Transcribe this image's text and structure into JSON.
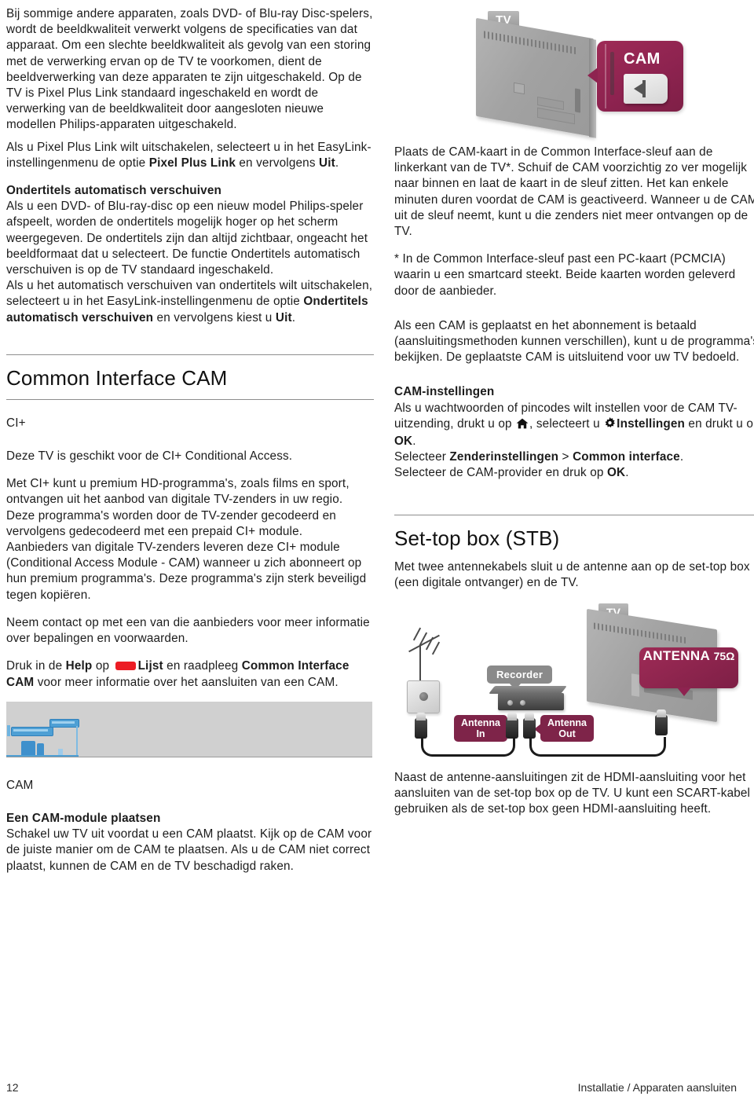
{
  "page": {
    "number": "12",
    "footer_right": "Installatie / Apparaten aansluiten"
  },
  "left_column": {
    "intro_paragraph": "Bij sommige andere apparaten, zoals DVD- of Blu-ray Disc-spelers, wordt de beeldkwaliteit verwerkt volgens de specificaties van dat apparaat. Om een slechte beeldkwaliteit als gevolg van een storing met de verwerking ervan op de TV te voorkomen, dient de beeldverwerking van deze apparaten te zijn uitgeschakeld. Op de TV is Pixel Plus Link standaard ingeschakeld en wordt de verwerking van de beeldkwaliteit door aangesloten nieuwe modellen Philips-apparaten uitgeschakeld.",
    "pixel_plus_p1": "Als u Pixel Plus Link wilt uitschakelen, selecteert u in het EasyLink-instellingenmenu de optie ",
    "pixel_plus_bold1": "Pixel Plus Link",
    "pixel_plus_p2": " en vervolgens ",
    "pixel_plus_bold2": "Uit",
    "pixel_plus_p3": ".",
    "subtitles_heading": "Ondertitels automatisch verschuiven",
    "subtitles_p1": "Als u een DVD- of Blu-ray-disc op een nieuw model Philips-speler afspeelt, worden de ondertitels mogelijk hoger op het scherm weergegeven. De ondertitels zijn dan altijd zichtbaar, ongeacht het beeldformaat dat u selecteert. De functie Ondertitels automatisch verschuiven is op de TV standaard ingeschakeld.",
    "subtitles_p2a": "Als u het automatisch verschuiven van ondertitels wilt uitschakelen, selecteert u in het EasyLink-instellingenmenu de optie ",
    "subtitles_bold1": "Ondertitels automatisch verschuiven",
    "subtitles_p2b": " en vervolgens kiest u ",
    "subtitles_bold2": "Uit",
    "subtitles_p2c": ".",
    "section_title": "Common Interface CAM",
    "ciplus_label": "CI+",
    "ciplus_p1": "Deze TV is geschikt voor de CI+ Conditional Access.",
    "ciplus_p2": "Met CI+ kunt u premium HD-programma's, zoals films en sport, ontvangen uit het aanbod van digitale TV-zenders in uw regio. Deze programma's worden door de TV-zender gecodeerd en vervolgens gedecodeerd met een prepaid CI+ module.",
    "ciplus_p3": "Aanbieders van digitale TV-zenders leveren deze CI+ module (Conditional Access Module - CAM) wanneer u zich abonneert op hun premium programma's. Deze programma's zijn sterk beveiligd tegen kopiëren.",
    "ciplus_p4": "Neem contact op met een van die aanbieders voor meer informatie over bepalingen en voorwaarden.",
    "help_p1": "Druk in de ",
    "help_bold1": "Help",
    "help_p2": " op ",
    "help_key_icon": "red-list-key-icon",
    "help_bold2": "Lijst",
    "help_p3": " en raadpleeg ",
    "help_bold3": "Common Interface CAM",
    "help_p4": " voor meer informatie over het aansluiten van een CAM.",
    "cam_label": "CAM",
    "cam_module_heading": "Een CAM-module plaatsen",
    "cam_module_p": "Schakel uw TV uit voordat u een CAM plaatst. Kijk op de CAM voor de juiste manier om de CAM te plaatsen. Als u de CAM niet correct plaatst, kunnen de CAM en de TV beschadigd raken."
  },
  "right_column": {
    "tv_cam_illustration": {
      "tv_label": "TV",
      "cam_label": "CAM"
    },
    "cam_insert_p": "Plaats de CAM-kaart in de Common Interface-sleuf aan de linkerkant van de TV*. Schuif de CAM voorzichtig zo ver mogelijk naar binnen en laat de kaart in de sleuf zitten. Het kan enkele minuten duren voordat de CAM is geactiveerd. Wanneer u de CAM uit de sleuf neemt, kunt u die zenders niet meer ontvangen op de TV.",
    "footnote_p": "* In de Common Interface-sleuf past een PC-kaart (PCMCIA) waarin u een smartcard steekt. Beide kaarten worden geleverd door de aanbieder.",
    "subscription_p": "Als een CAM is geplaatst en het abonnement is betaald (aansluitingsmethoden kunnen verschillen), kunt u de programma's bekijken. De geplaatste CAM is uitsluitend voor uw TV bedoeld.",
    "cam_settings_heading": "CAM-instellingen",
    "cam_settings_p1a": "Als u wachtwoorden of pincodes wilt instellen voor de CAM TV-uitzending, drukt u op ",
    "cam_settings_home_icon": "home-icon",
    "cam_settings_p1b": ", selecteert u ",
    "cam_settings_gear_icon": "gear-icon",
    "cam_settings_bold1": "Instellingen",
    "cam_settings_p1c": " en drukt u op ",
    "cam_settings_bold2": "OK",
    "cam_settings_p1d": ".",
    "cam_settings_p2a": "Selecteer ",
    "cam_settings_bold3": "Zenderinstellingen",
    "cam_settings_p2b": " > ",
    "cam_settings_bold4": "Common interface",
    "cam_settings_p2c": ".",
    "cam_settings_p3a": "Selecteer de CAM-provider en druk op ",
    "cam_settings_bold5": "OK",
    "cam_settings_p3b": ".",
    "stb_section_title": "Set-top box (STB)",
    "stb_p1": "Met twee antennekabels sluit u de antenne aan op de set-top box (een digitale ontvanger) en de TV.",
    "stb_illustration": {
      "tv_label": "TV",
      "recorder_label": "Recorder",
      "antenna_in_line1": "Antenna",
      "antenna_in_line2": "In",
      "antenna_out_line1": "Antenna",
      "antenna_out_line2": "Out",
      "antenna_badge_line1": "ANTENNA",
      "antenna_badge_line2": "75Ω"
    },
    "stb_p2": "Naast de antenne-aansluitingen zit de HDMI-aansluiting voor het aansluiten van de set-top box op de TV. U kunt een SCART-kabel gebruiken als de set-top box geen HDMI-aansluiting heeft."
  },
  "colors": {
    "accent_red": "#ec1c24",
    "maroon": "#8e2350",
    "gray_label": "#8a8a8a",
    "rule": "#8d8d8d"
  }
}
